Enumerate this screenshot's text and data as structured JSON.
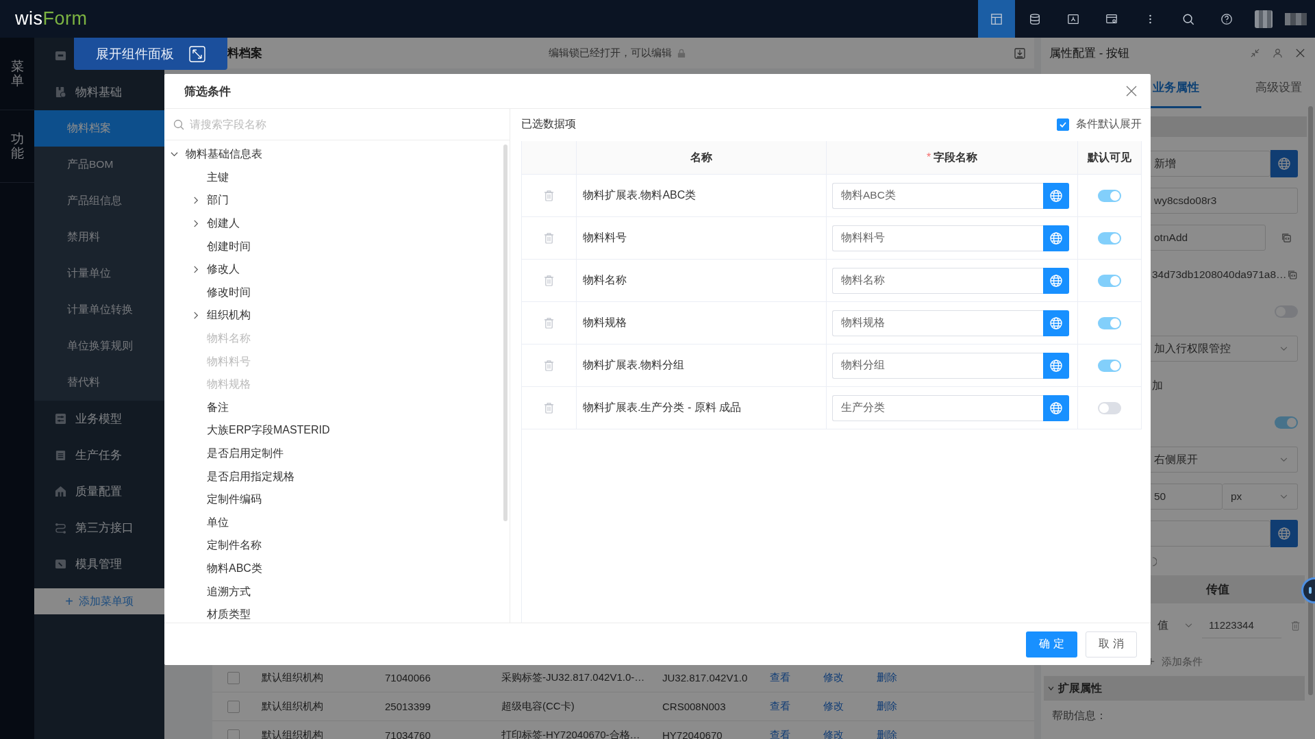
{
  "topbar": {
    "logo_prefix": "wis",
    "logo_suffix": "Form",
    "tools": [
      {
        "selected": true
      },
      {
        "selected": false
      },
      {
        "selected": false
      },
      {
        "selected": false
      },
      {
        "selected": false
      },
      {
        "selected": false
      },
      {
        "selected": false
      }
    ]
  },
  "rail": [
    {
      "label": "菜单",
      "selected": false
    },
    {
      "label": "功能",
      "selected": false
    }
  ],
  "sidebar": {
    "items": [
      {
        "label": "物料基础",
        "children": [
          {
            "label": "物料档案",
            "selected": true
          },
          {
            "label": "产品BOM",
            "selected": false
          },
          {
            "label": "产品组信息",
            "selected": false
          },
          {
            "label": "禁用料",
            "selected": false
          },
          {
            "label": "计量单位",
            "selected": false
          },
          {
            "label": "计量单位转换",
            "selected": false
          },
          {
            "label": "单位换算规则",
            "selected": false
          },
          {
            "label": "替代料",
            "selected": false
          }
        ]
      },
      {
        "label": "业务模型"
      },
      {
        "label": "生产任务"
      },
      {
        "label": "质量配置"
      },
      {
        "label": "第三方接口"
      },
      {
        "label": "模具管理"
      }
    ],
    "add_button": {
      "icon": "+",
      "label": "添加菜单项"
    }
  },
  "expand_panel_button": "展开组件面板",
  "page": {
    "title": "料档案",
    "lock_notice": "编辑锁已经打开，可以编辑",
    "rows": [
      {
        "checked": false,
        "org": "默认组织机构",
        "code": "71040066",
        "name": "采购标签-JU32.817.042V1.0-…",
        "spec": "JU32.817.042V1.0",
        "actions": [
          "查看",
          "修改",
          "删除"
        ]
      },
      {
        "checked": false,
        "org": "默认组织机构",
        "code": "25013399",
        "name": "超级电容(CC卡)",
        "spec": "CRS008N003",
        "actions": [
          "查看",
          "修改",
          "删除"
        ]
      },
      {
        "checked": false,
        "org": "默认组织机构",
        "code": "71034760",
        "name": "打印标签-HY72040670-合格…",
        "spec": "HY72040670",
        "actions": [
          "查看",
          "修改",
          "删除"
        ]
      }
    ]
  },
  "props_panel": {
    "title": "属性配置 - 按钮",
    "tabs": [
      {
        "label": "业务属性",
        "selected": true
      },
      {
        "label": "高级设置",
        "selected": false
      }
    ],
    "fields": [
      {
        "kind": "globe",
        "value": "新增"
      },
      {
        "kind": "input",
        "value": "wy8csdo08r3"
      },
      {
        "kind": "copy",
        "value": "otnAdd"
      },
      {
        "kind": "text-copy",
        "value": "34d73db1208040da971a8…"
      },
      {
        "kind": "switch",
        "on": false
      },
      {
        "kind": "select",
        "value": "加入行权限管控"
      },
      {
        "kind": "text",
        "value": "加"
      },
      {
        "kind": "switch",
        "on": true
      },
      {
        "kind": "select",
        "value": "右侧展开"
      },
      {
        "kind": "unit",
        "value": "50",
        "unit": "px"
      },
      {
        "kind": "globe"
      },
      {
        "kind": "help"
      }
    ],
    "pass_header": "传值",
    "conditions": [
      {
        "type": "值",
        "value": "11223344"
      }
    ],
    "add_condition": {
      "icon": "+",
      "label": "添加条件"
    },
    "section": {
      "label": "扩展属性",
      "expanded": true
    },
    "help_label": "帮助信息："
  },
  "modal": {
    "title": "筛选条件",
    "search": {
      "placeholder": "请搜索字段名称"
    },
    "tree": [
      {
        "label": "物料基础信息表",
        "expanded": true,
        "children": [
          {
            "label": "主键",
            "expandable": false,
            "disabled": false
          },
          {
            "label": "部门",
            "expandable": true,
            "disabled": false
          },
          {
            "label": "创建人",
            "expandable": true,
            "disabled": false
          },
          {
            "label": "创建时间",
            "expandable": false,
            "disabled": false
          },
          {
            "label": "修改人",
            "expandable": true,
            "disabled": false
          },
          {
            "label": "修改时间",
            "expandable": false,
            "disabled": false
          },
          {
            "label": "组织机构",
            "expandable": true,
            "disabled": false
          },
          {
            "label": "物料名称",
            "expandable": false,
            "disabled": true
          },
          {
            "label": "物料料号",
            "expandable": false,
            "disabled": true
          },
          {
            "label": "物料规格",
            "expandable": false,
            "disabled": true
          },
          {
            "label": "备注",
            "expandable": false,
            "disabled": false
          },
          {
            "label": "大族ERP字段MASTERID",
            "expandable": false,
            "disabled": false
          },
          {
            "label": "是否启用定制件",
            "expandable": false,
            "disabled": false
          },
          {
            "label": "是否启用指定规格",
            "expandable": false,
            "disabled": false
          },
          {
            "label": "定制件编码",
            "expandable": false,
            "disabled": false
          },
          {
            "label": "单位",
            "expandable": false,
            "disabled": false
          },
          {
            "label": "定制件名称",
            "expandable": false,
            "disabled": false
          },
          {
            "label": "物料ABC类",
            "expandable": false,
            "disabled": false
          },
          {
            "label": "追溯方式",
            "expandable": false,
            "disabled": false
          },
          {
            "label": "材质类型",
            "expandable": false,
            "disabled": false
          }
        ]
      }
    ],
    "selected_title": "已选数据项",
    "expand_default": {
      "label": "条件默认展开",
      "checked": true
    },
    "columns": [
      {
        "label": "名称"
      },
      {
        "label": "字段名称",
        "mark": "*"
      },
      {
        "label": "默认可见"
      }
    ],
    "rows": [
      {
        "name": "物料扩展表.物料ABC类",
        "field": "物料ABC类",
        "visible": true
      },
      {
        "name": "物料料号",
        "field": "物料料号",
        "visible": true
      },
      {
        "name": "物料名称",
        "field": "物料名称",
        "visible": true
      },
      {
        "name": "物料规格",
        "field": "物料规格",
        "visible": true
      },
      {
        "name": "物料扩展表.物料分组",
        "field": "物料分组",
        "visible": true
      },
      {
        "name": "物料扩展表.生产分类 - 原料 成品",
        "field": "生产分类",
        "visible": false
      }
    ],
    "confirm": "确 定",
    "cancel": "取 消"
  }
}
